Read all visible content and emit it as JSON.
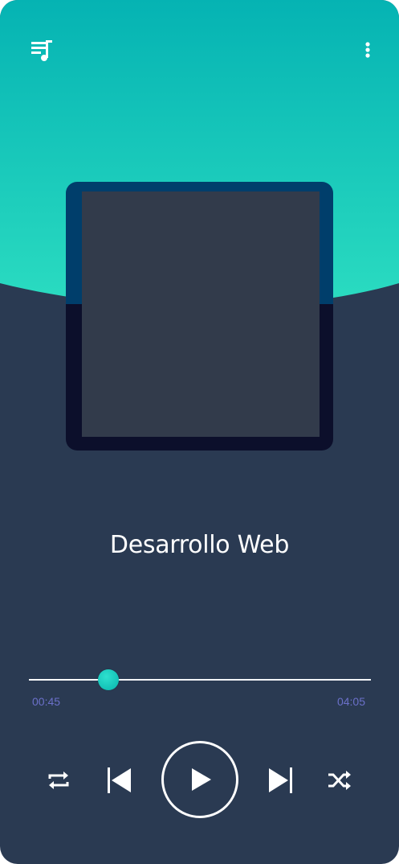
{
  "player": {
    "track_title": "Desarrollo Web",
    "time_current": "00:45",
    "time_total": "04:05",
    "progress": 0.232,
    "colors": {
      "accent_top": "#0cb7b0",
      "accent_bottom": "#27d3bd",
      "background": "#2a3a52",
      "time_text": "#6b70c9"
    }
  },
  "icons": {
    "playlist": "playlist-icon",
    "more": "more-vertical-icon",
    "repeat": "repeat-icon",
    "previous": "skip-previous-icon",
    "play": "play-icon",
    "next": "skip-next-icon",
    "shuffle": "shuffle-icon"
  }
}
